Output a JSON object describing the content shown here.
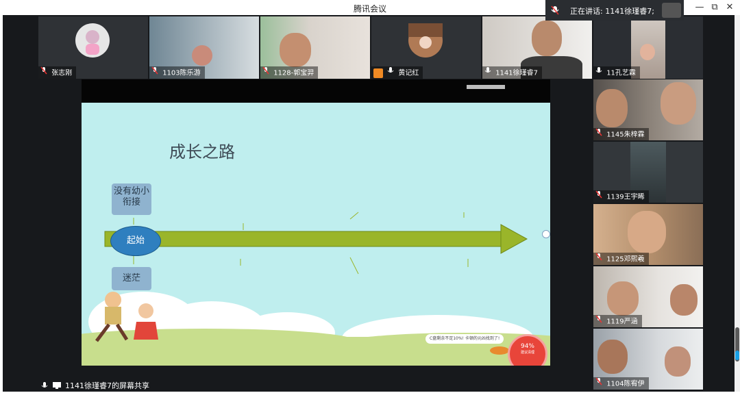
{
  "app": {
    "title": "腾讯会议"
  },
  "speaking": {
    "text": "正在讲话:  1141徐瑾睿7;"
  },
  "window_controls": {
    "minimize": "—",
    "restore": "⧉",
    "close": "✕"
  },
  "top_row": [
    {
      "name": "张志刚",
      "muted": true,
      "host": false
    },
    {
      "name": "1103陈乐游",
      "muted": true,
      "host": false
    },
    {
      "name": "1128-郭宝羿",
      "muted": true,
      "host": false
    },
    {
      "name": "黄记红",
      "muted": false,
      "host": true
    },
    {
      "name": "1141徐瑾睿7",
      "muted": false,
      "host": false,
      "active": true
    },
    {
      "name": "11孔艺霖",
      "muted": false,
      "host": false
    }
  ],
  "side_column": [
    {
      "name": "1145朱梓霖"
    },
    {
      "name": "1139王宇晞"
    },
    {
      "name": "1125邓熙羲"
    },
    {
      "name": "1119严涵"
    },
    {
      "name": "1104陈宥伊"
    }
  ],
  "slide": {
    "title": "成长之路",
    "box_top": "没有幼小衔接",
    "start": "起始",
    "box_bottom": "迷茫",
    "banner": "C盘剩余不足10%!  卡顿的元凶找到了!",
    "badge_percent": "94%",
    "badge_caption": "建议清理"
  },
  "footer": {
    "share_text": "1141徐瑾睿7的屏幕共享"
  }
}
